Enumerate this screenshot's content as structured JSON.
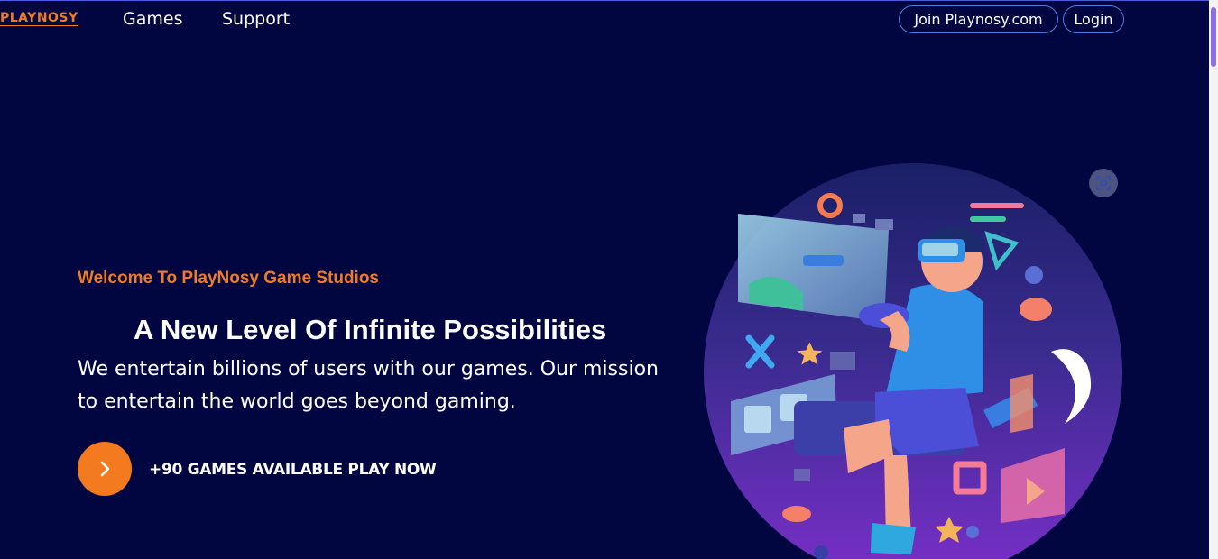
{
  "header": {
    "logo_text": "PLAYNOSY",
    "nav": {
      "games": "Games",
      "support": "Support"
    },
    "join_label": "Join Playnosy.com",
    "login_label": "Login"
  },
  "hero": {
    "eyebrow": "Welcome To PlayNosy Game Studios",
    "headline": "A New Level Of Infinite Possibilities",
    "subtext": "We entertain billions of users with our games. Our mission to entertain the world goes beyond gaming.",
    "cta_label": "+90 GAMES AVAILABLE PLAY NOW",
    "cta_icon": "chevron-right-icon"
  },
  "illustration": {
    "subject": "vr-gamer-illustration",
    "scan_icon": "visual-search-icon"
  },
  "colors": {
    "background": "#010641",
    "accent": "#f07a26",
    "pill_border": "#4c7ce0"
  }
}
